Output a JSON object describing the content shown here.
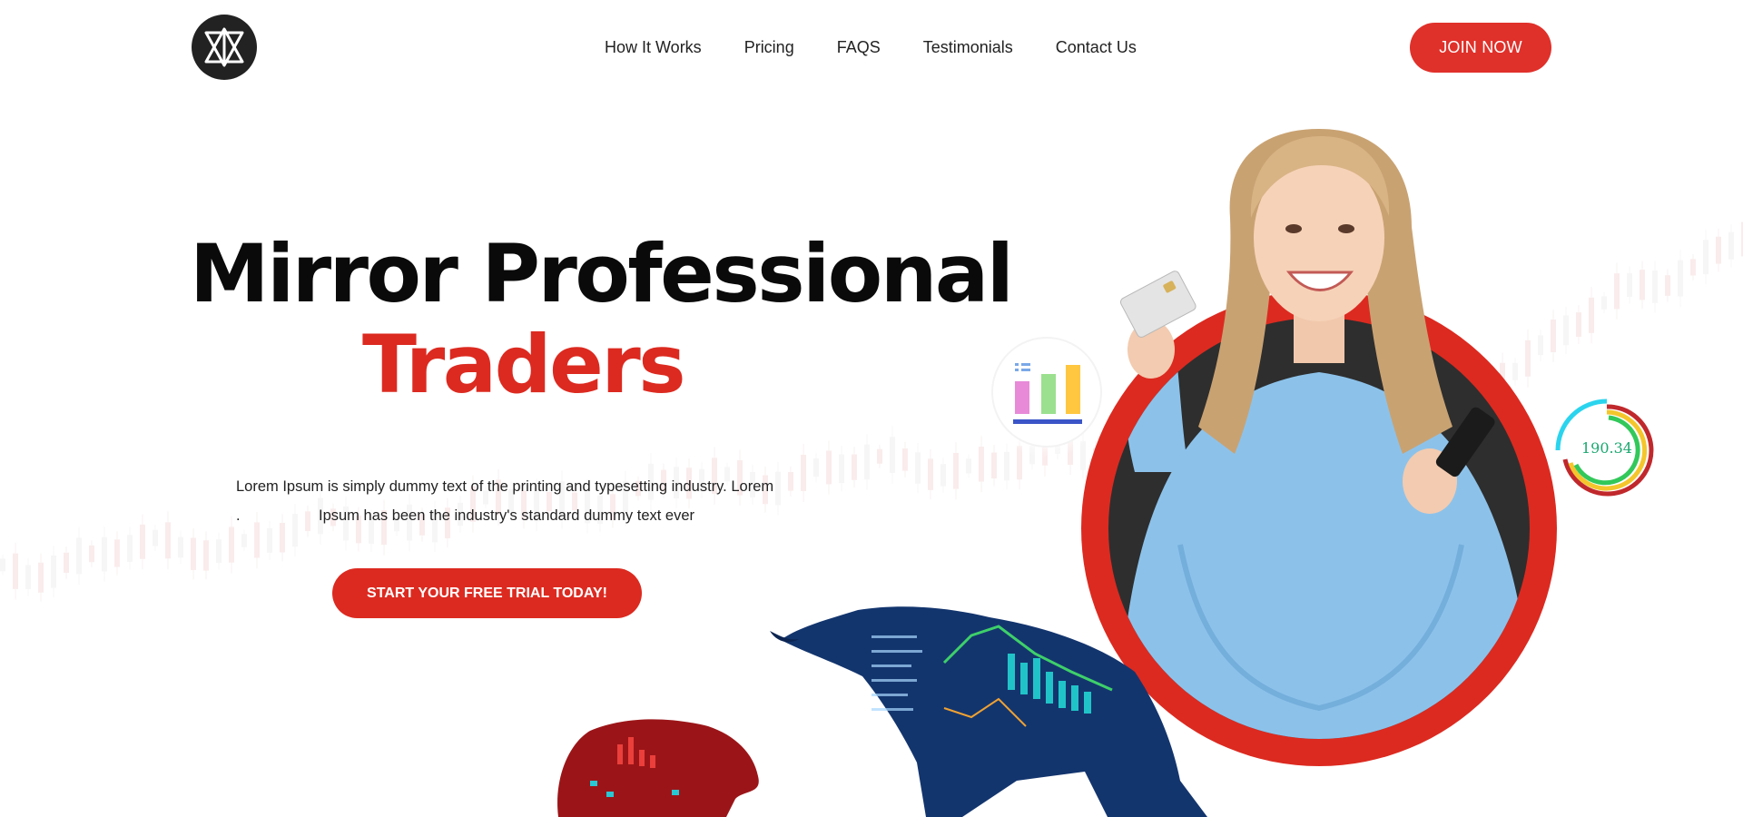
{
  "header": {
    "logo_icon": "interlocked-triangle-logo-icon",
    "nav": [
      {
        "label": "How It Works"
      },
      {
        "label": "Pricing"
      },
      {
        "label": "FAQS"
      },
      {
        "label": "Testimonials"
      },
      {
        "label": "Contact Us"
      }
    ],
    "join_label": "JOIN NOW"
  },
  "hero": {
    "title_line1": "Mirror Professional",
    "title_line2": "Traders",
    "desc_line1": "Lorem Ipsum is simply dummy text of the printing and typesetting industry. Lorem",
    "desc_dot": ".",
    "desc_line2": "Ipsum has been the industry's standard dummy text ever",
    "cta_label": "START YOUR FREE TRIAL TODAY!",
    "stat_value": "190.34"
  },
  "colors": {
    "accent_red": "#dc2a20",
    "button_red": "#e0302a",
    "sweater_blue": "#8cc2ea",
    "bull_blue": "#13356e",
    "bear_red": "#9b1518",
    "gauge_green": "#1aa870"
  }
}
